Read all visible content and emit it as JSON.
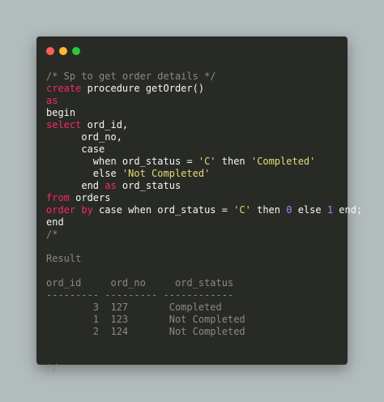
{
  "window": {
    "title": "",
    "buttons": {
      "close": "close",
      "minimize": "minimize",
      "maximize": "maximize"
    },
    "colors": {
      "close": "#ff5f57",
      "minimize": "#febc2e",
      "maximize": "#28c840",
      "background": "#282a26",
      "keyword": "#f92672",
      "string": "#e6db74",
      "number": "#ae81ff",
      "comment": "#8a8a80"
    }
  },
  "code": {
    "l1": "/* Sp to get order details */",
    "l2": {
      "kw": "create",
      "rest": " procedure getOrder()"
    },
    "l3": "as",
    "l4": "begin",
    "l5": {
      "kw": "select",
      "rest": " ord_id,"
    },
    "l6": "      ord_no,",
    "l7": "      case",
    "l8": {
      "pre": "        when ord_status = ",
      "s1": "'C'",
      "mid": " then ",
      "s2": "'Completed'"
    },
    "l9": {
      "pre": "        else ",
      "s1": "'Not Completed'"
    },
    "l10": {
      "pre": "      end ",
      "kw": "as",
      "rest": " ord_status"
    },
    "l11": {
      "kw": "from",
      "rest": " orders"
    },
    "l12": {
      "kw": "order by",
      "pre": " case when ord_status = ",
      "s1": "'C'",
      "mid": " then ",
      "n1": "0",
      "mid2": " else ",
      "n2": "1",
      "end": " end;"
    },
    "l13": "end",
    "l14": "/*",
    "l15": "",
    "l16": "Result",
    "l17": "",
    "l18": "ord_id     ord_no     ord_status",
    "l19": "--------- --------- ------------",
    "l20": "        3  127       Completed",
    "l21": "        1  123       Not Completed",
    "l22": "        2  124       Not Completed",
    "l23": "",
    "l24": "",
    "l25": "*/"
  }
}
